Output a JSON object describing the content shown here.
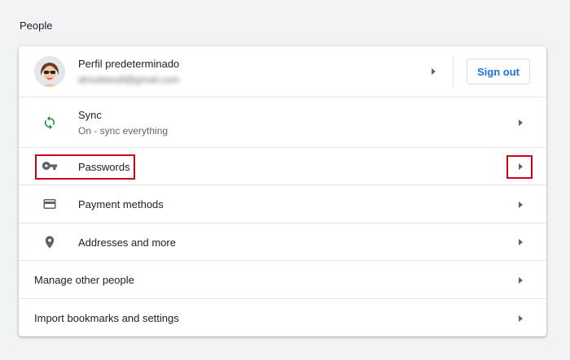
{
  "section": {
    "title": "People"
  },
  "profile": {
    "name": "Perfil predeterminado",
    "email": "ahsubiesdl@gmail.com",
    "sign_out_label": "Sign out",
    "avatar_icon": "avatar-woman-sunglasses"
  },
  "rows": [
    {
      "label": "Sync",
      "sublabel": "On - sync everything",
      "icon": "sync-icon",
      "icon_color": "#1e8e3e"
    },
    {
      "label": "Passwords",
      "icon": "key-icon"
    },
    {
      "label": "Payment methods",
      "icon": "credit-card-icon"
    },
    {
      "label": "Addresses and more",
      "icon": "location-pin-icon"
    },
    {
      "label": "Manage other people"
    },
    {
      "label": "Import bookmarks and settings"
    }
  ],
  "colors": {
    "accent": "#1a73e8",
    "highlight": "#d0021b",
    "text_secondary": "#5f6368"
  }
}
